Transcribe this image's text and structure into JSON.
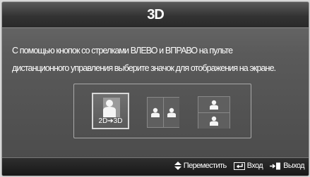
{
  "title": "3D",
  "description": [
    "С помощью кнопок со стрелками ВЛЕВО и ВПРАВО на пульте",
    "дистанционного управления выберите значок для отображения на экране."
  ],
  "options": [
    {
      "label": "2D➔3D",
      "icon": "person-icon",
      "selected": true
    },
    {
      "label": "",
      "icon": "side-by-side-icon",
      "selected": false
    },
    {
      "label": "",
      "icon": "top-bottom-icon",
      "selected": false
    }
  ],
  "footer": {
    "move_label": "Переместить",
    "enter_label": "Вход",
    "exit_label": "Выход"
  }
}
